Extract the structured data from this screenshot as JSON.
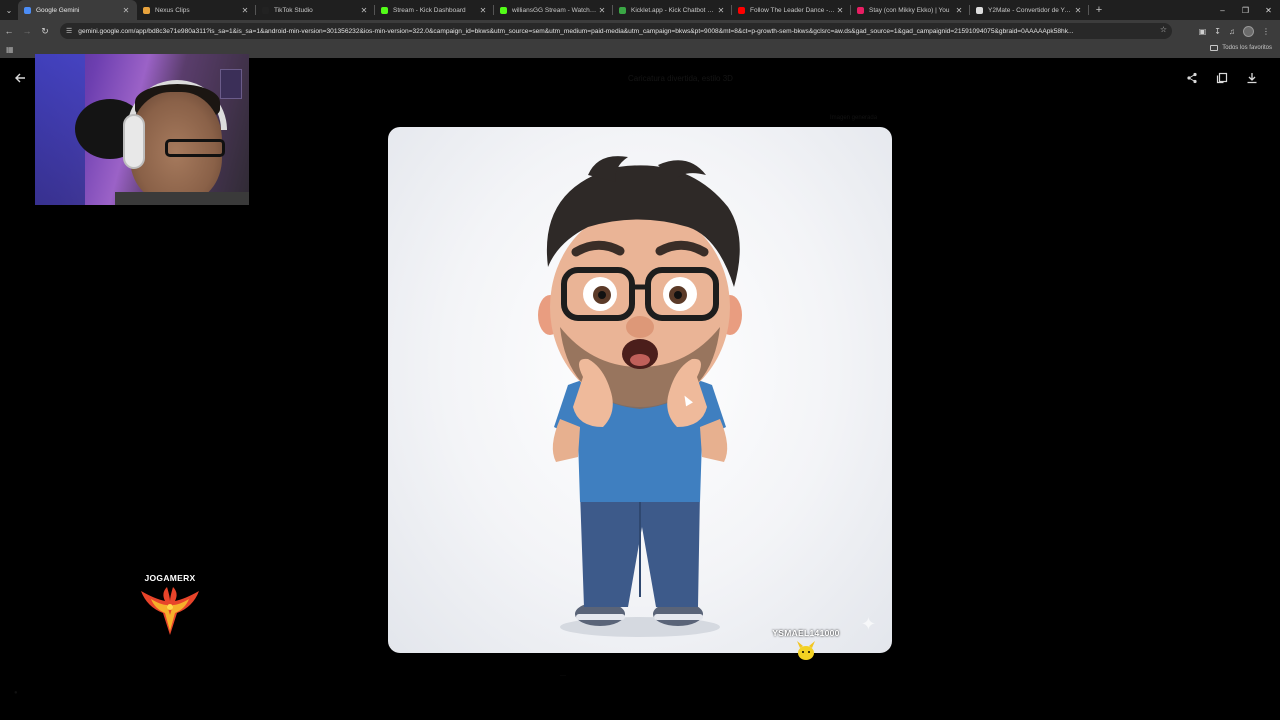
{
  "browser": {
    "tabs": [
      {
        "label": "Google Gemini",
        "active": true,
        "favicon_color": "#4c8df6"
      },
      {
        "label": "Nexus Clips",
        "active": false,
        "favicon_color": "#e8a33d"
      },
      {
        "label": "TikTok Studio",
        "active": false,
        "favicon_color": "#222222"
      },
      {
        "label": "Stream - Kick Dashboard",
        "active": false,
        "favicon_color": "#53fc18"
      },
      {
        "label": "williansGG Stream - Watch Live",
        "active": false,
        "favicon_color": "#53fc18"
      },
      {
        "label": "Kicklet.app - Kick Chatbot and",
        "active": false,
        "favicon_color": "#3aa745"
      },
      {
        "label": "Follow The Leader Dance - You",
        "active": false,
        "favicon_color": "#ff0000"
      },
      {
        "label": "Stay (con Mikky Ekko) | You",
        "active": false,
        "favicon_color": "#e91e63"
      },
      {
        "label": "Y2Mate - Convertidor de YouTu",
        "active": false,
        "favicon_color": "#dddddd"
      }
    ],
    "new_tab": "+",
    "url": "gemini.google.com/app/bd8c3e71e980a311?is_sa=1&is_sa=1&android-min-version=301356232&ios-min-version=322.0&campaign_id=bkws&utm_source=sem&utm_medium=paid-media&utm_campaign=bkws&pt=9008&mt=8&ct=p-growth-sem-bkws&gclsrc=aw.ds&gad_source=1&gad_campaignid=21591094075&gbraid=0AAAAApk58hk...",
    "bookmarks_all": "Todos los favoritos"
  },
  "viewer": {
    "faded_title": "Caricatura divertida, estilo 3D",
    "faded_sub": "Imagen generada"
  },
  "overlay": {
    "left_name": "JOGAMERX",
    "right_name": "YSMAEL141000"
  },
  "colors": {
    "page_bg": "#000000",
    "chrome_bg": "#3c3c3c",
    "tabstrip_bg": "#1f1f1f"
  }
}
